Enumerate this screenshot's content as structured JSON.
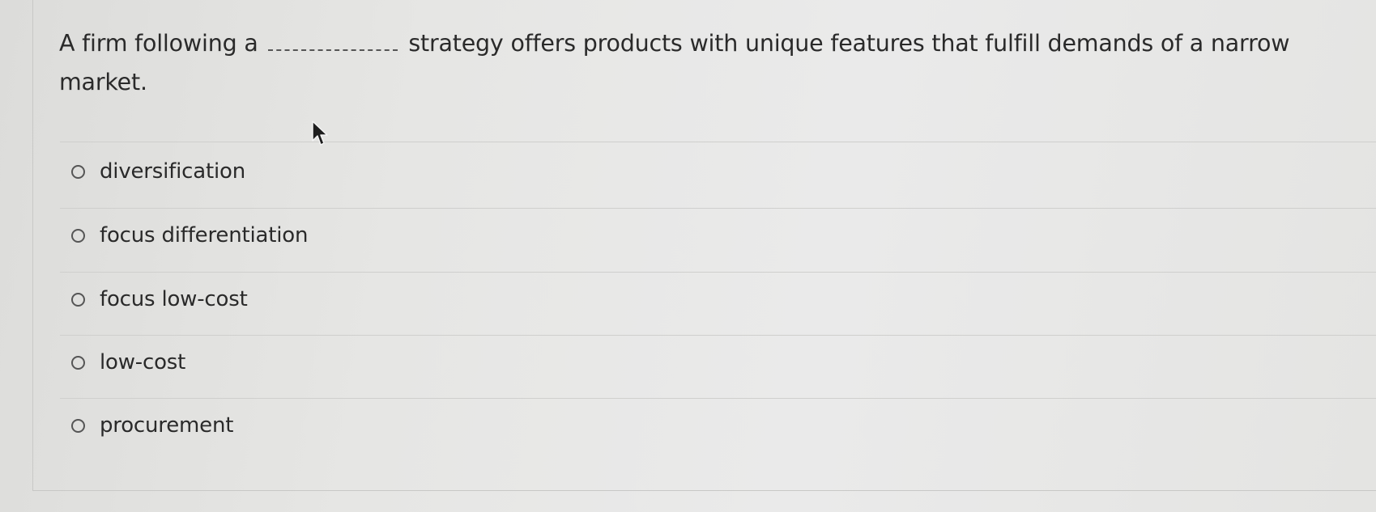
{
  "question": {
    "text_before": "A firm following a",
    "text_after": "strategy offers products with unique features that fulfill demands of a narrow market."
  },
  "options": [
    {
      "label": "diversification",
      "selected": false
    },
    {
      "label": "focus differentiation",
      "selected": false
    },
    {
      "label": "focus low-cost",
      "selected": false
    },
    {
      "label": "low-cost",
      "selected": false
    },
    {
      "label": "procurement",
      "selected": false
    }
  ],
  "icons": {
    "cursor": "mouse-pointer-icon",
    "radio": "radio-button-unselected"
  }
}
